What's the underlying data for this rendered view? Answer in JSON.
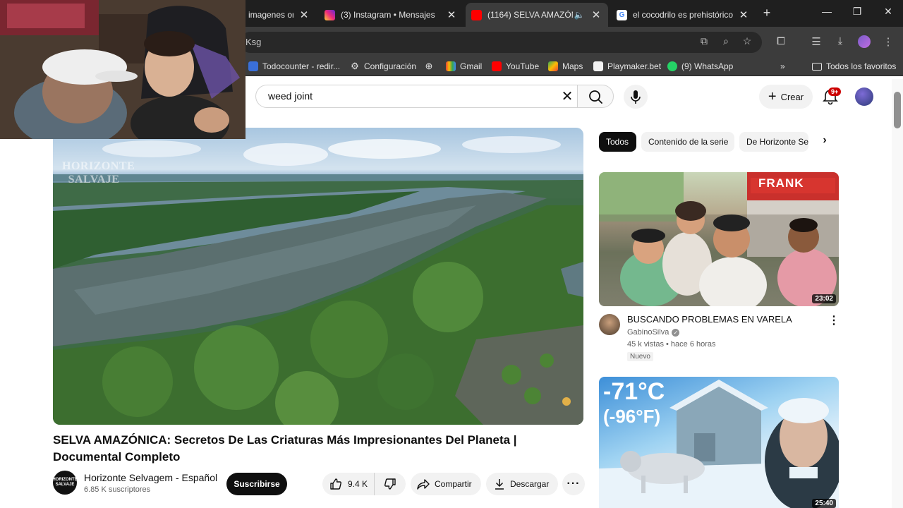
{
  "browser": {
    "tabs": [
      {
        "title": "imagenes on",
        "favicon": "doc-icon",
        "active": false
      },
      {
        "title": "(3) Instagram • Mensajes",
        "favicon": "instagram-icon",
        "active": false
      },
      {
        "title": "(1164) SELVA AMAZÓNI",
        "favicon": "youtube-icon",
        "active": true
      },
      {
        "title": "el cocodrilo es prehistórico",
        "favicon": "google-icon",
        "active": false
      }
    ],
    "url_fragment": "Ksg",
    "bookmarks": [
      {
        "label": "Todocounter - redir..."
      },
      {
        "label": "Configuración"
      },
      {
        "label": "Gmail"
      },
      {
        "label": "YouTube"
      },
      {
        "label": "Maps"
      },
      {
        "label": "Playmaker.bet"
      },
      {
        "label": "(9) WhatsApp"
      }
    ],
    "all_bookmarks_label": "Todos los favoritos"
  },
  "youtube": {
    "search": {
      "value": "weed joint"
    },
    "create_label": "Crear",
    "notifications_badge": "9+",
    "video": {
      "title": "SELVA AMAZÓNICA: Secretos De Las Criaturas Más Impresionantes Del Planeta | Documental Completo",
      "watermark": "HORIZONTE SALVAJE",
      "channel": {
        "name": "Horizonte Selvagem - Español",
        "subscribers": "6.85 K suscriptores",
        "avatar_text": "HORIZONTE SALVAJE"
      },
      "subscribe_label": "Suscribirse",
      "likes": "9.4 K",
      "share_label": "Compartir",
      "download_label": "Descargar"
    },
    "chips": [
      {
        "label": "Todos",
        "active": true
      },
      {
        "label": "Contenido de la serie",
        "active": false
      },
      {
        "label": "De Horizonte Se",
        "active": false
      }
    ],
    "recommendations": [
      {
        "title": "BUSCANDO PROBLEMAS EN VARELA",
        "channel": "GabinoSilva",
        "meta": "45 k vistas • hace 6 horas",
        "badge": "Nuevo",
        "duration": "23:02",
        "thumb_sign": "FRANK"
      },
      {
        "duration": "25:40",
        "thumb_text_line1": "-71°C",
        "thumb_text_line2": "(-96°F)"
      }
    ]
  }
}
